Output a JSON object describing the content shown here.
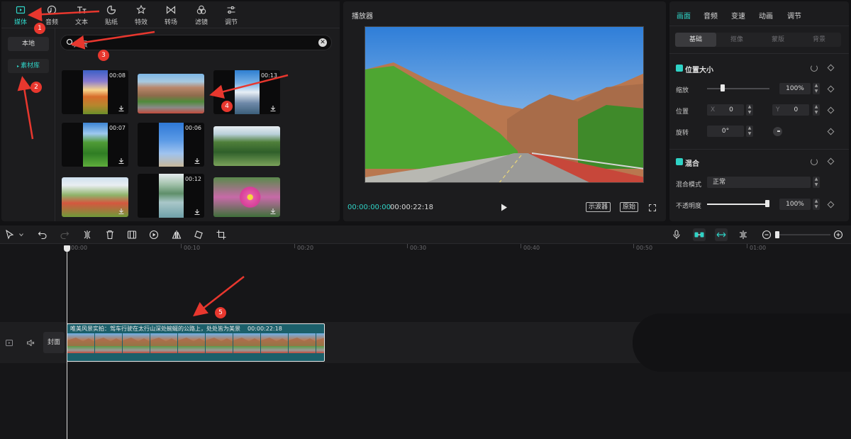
{
  "media_tabs": [
    {
      "label": "媒体",
      "icon": "media-icon"
    },
    {
      "label": "音频",
      "icon": "audio-icon"
    },
    {
      "label": "文本",
      "icon": "text-icon"
    },
    {
      "label": "贴纸",
      "icon": "sticker-icon"
    },
    {
      "label": "特效",
      "icon": "effects-icon"
    },
    {
      "label": "转场",
      "icon": "transition-icon"
    },
    {
      "label": "滤镜",
      "icon": "filter-icon"
    },
    {
      "label": "调节",
      "icon": "adjust-icon"
    }
  ],
  "left_nav": [
    "本地",
    "素材库"
  ],
  "search": {
    "value": "风景"
  },
  "thumbnails": [
    {
      "duration": "00:08"
    },
    {
      "duration": ""
    },
    {
      "duration": "00:13"
    },
    {
      "duration": "00:07"
    },
    {
      "duration": "00:06"
    },
    {
      "duration": ""
    },
    {
      "duration": ""
    },
    {
      "duration": "00:12"
    },
    {
      "duration": ""
    }
  ],
  "player": {
    "title": "播放器",
    "current_time": "00:00:00:00",
    "total_time": "00:00:22:18",
    "scope_label": "示波器",
    "original_label": "原始"
  },
  "inspector": {
    "tabs": [
      "画面",
      "音频",
      "变速",
      "动画",
      "调节"
    ],
    "subtabs": [
      "基础",
      "抠像",
      "蒙版",
      "背景"
    ],
    "pos_size_title": "位置大小",
    "scale_label": "缩放",
    "scale_value": "100%",
    "scale_fraction": 0.25,
    "position_label": "位置",
    "x_label": "X",
    "x_value": "0",
    "y_label": "Y",
    "y_value": "0",
    "rotate_label": "旋转",
    "rotate_value": "0°",
    "blend_title": "混合",
    "blend_mode_label": "混合模式",
    "blend_mode_value": "正常",
    "opacity_label": "不透明度",
    "opacity_value": "100%",
    "opacity_fraction": 1.0
  },
  "timeline": {
    "ruler_labels": [
      "00:00",
      "00:10",
      "00:20",
      "00:30",
      "00:40",
      "00:50",
      "01:00"
    ],
    "clip_title": "唯美风景实拍：驾车行驶在太行山深处蜿蜒的公路上，处处皆为美景",
    "clip_duration": "00:00:22:18",
    "cover_label": "封面"
  },
  "annotations": [
    "1",
    "2",
    "3",
    "4",
    "5"
  ],
  "colors": {
    "accent": "#2fd3c6",
    "annotation": "#e8372e",
    "clip": "#1b5f6a"
  }
}
